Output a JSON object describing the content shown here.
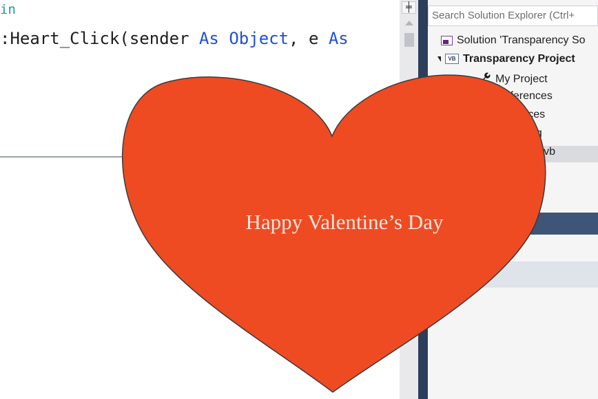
{
  "editor": {
    "line1": "in",
    "line2_prefix": ":Heart_Click(sender ",
    "line2_kw1": "As",
    "line2_space1": " ",
    "line2_kw2": "Object",
    "line2_mid": ", e ",
    "line2_kw3": "As",
    "split_glyph": "╪"
  },
  "solution_explorer": {
    "search_placeholder": "Search Solution Explorer (Ctrl+",
    "items": [
      {
        "label": "Solution 'Transparency So",
        "icon": "solution-icon"
      },
      {
        "label": "Transparency Project",
        "icon": "vb-project-icon",
        "icon_text": "VB",
        "bold": true
      },
      {
        "label": "My Project",
        "icon": "wrench-icon"
      },
      {
        "label": "References",
        "icon": "references-icon"
      },
      {
        "label": "urces",
        "icon": "resources-icon"
      },
      {
        "label": "nfig",
        "icon": "config-icon"
      },
      {
        "label": "rm.vb",
        "icon": "form-icon"
      }
    ]
  },
  "heart": {
    "text": "Happy Valentine’s Day",
    "fill": "#ee4b23"
  },
  "colors": {
    "keyword": "#1f4fd6",
    "dark_separator": "#2d3e5c",
    "properties_header": "#3e5577"
  }
}
